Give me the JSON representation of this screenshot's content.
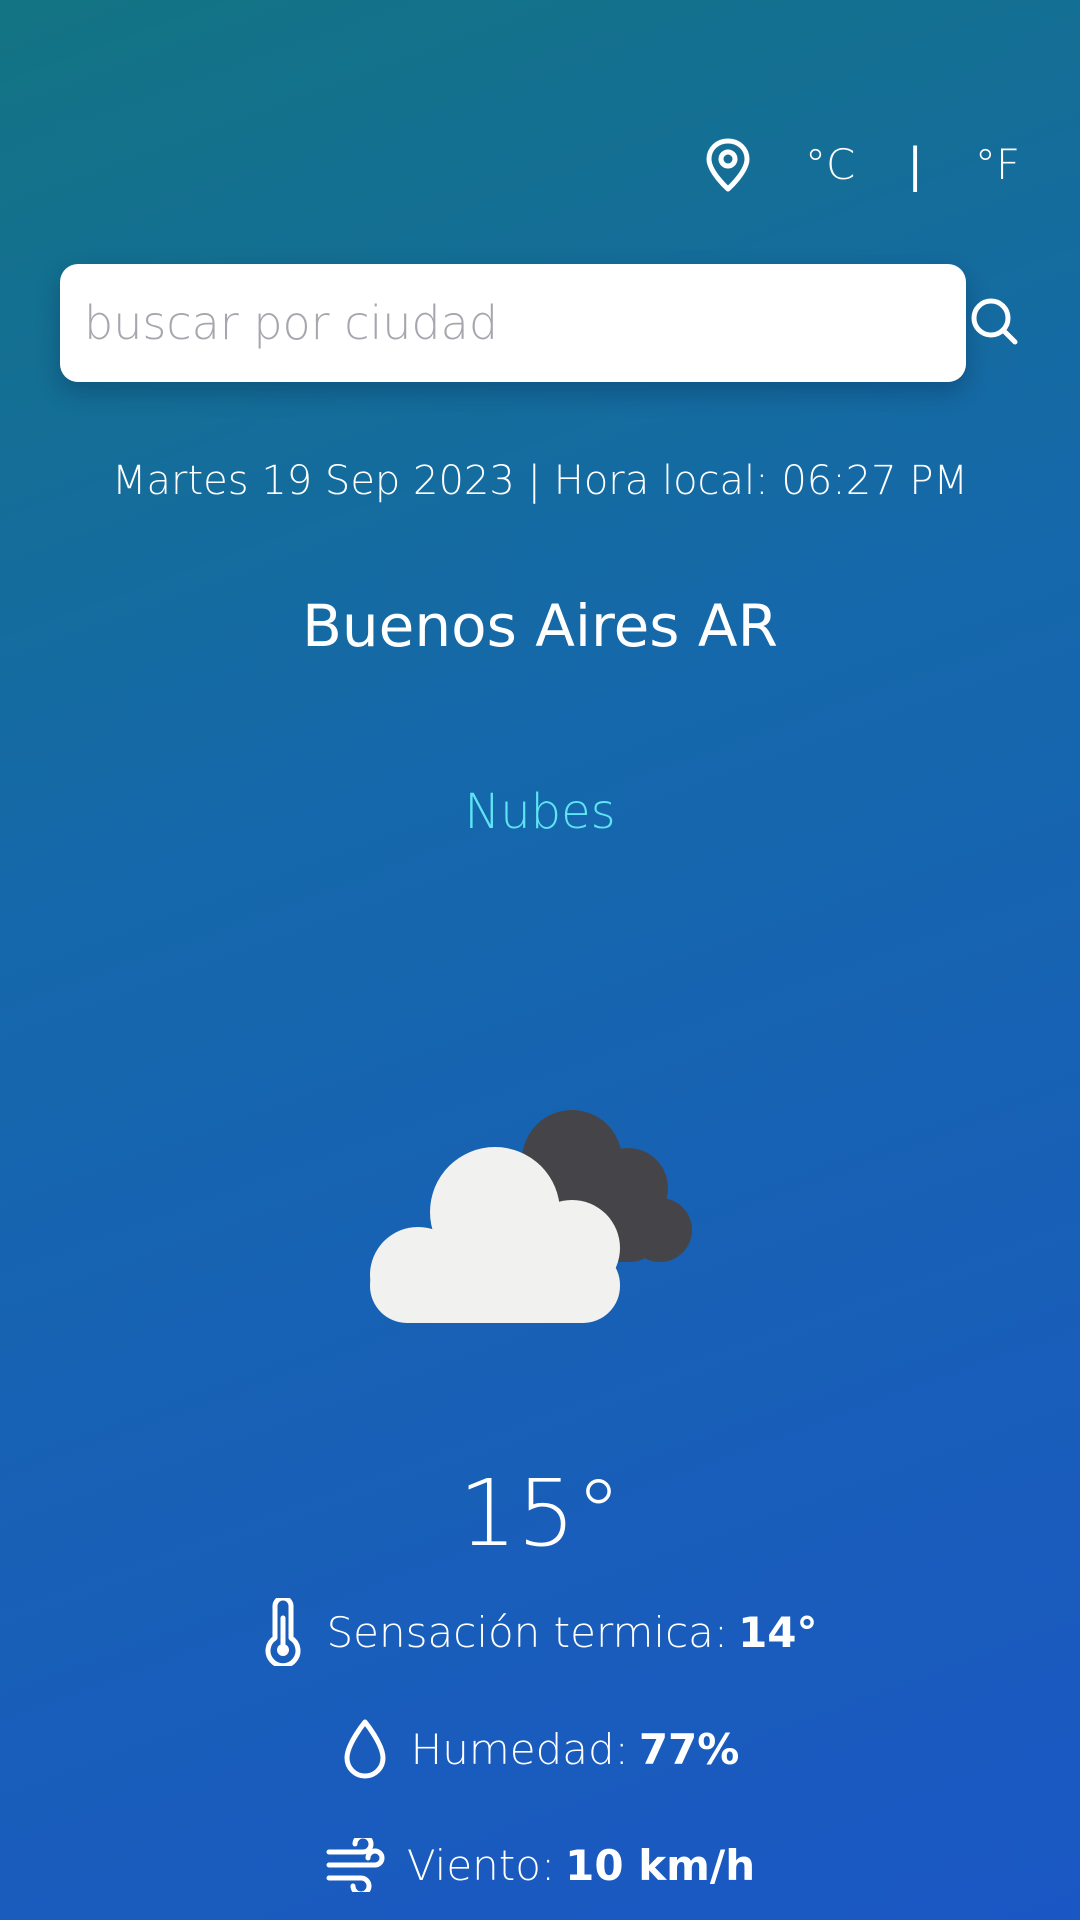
{
  "header": {
    "location_icon": "map-pin-icon",
    "unit_celsius": "°C",
    "unit_separator": "|",
    "unit_fahrenheit": "°F"
  },
  "search": {
    "placeholder": "buscar por ciudad",
    "value": "",
    "icon": "search-icon"
  },
  "weather": {
    "date_line": "Martes 19 Sep 2023 | Hora local: 06:27 PM",
    "city": "Buenos Aires AR",
    "condition": "Nubes",
    "icon": "cloudy-icon",
    "temperature": "15°"
  },
  "details": {
    "feels_like_label": "Sensación termica:",
    "feels_like_value": "14°",
    "humidity_label": "Humedad:",
    "humidity_value": "77%",
    "wind_label": "Viento:",
    "wind_value": "10 km/h"
  },
  "colors": {
    "gradient_start": "#137483",
    "gradient_end": "#1b57c4",
    "condition_text": "#5ee4f4",
    "cloud_front": "#f1f1ef",
    "cloud_back": "#454549"
  }
}
